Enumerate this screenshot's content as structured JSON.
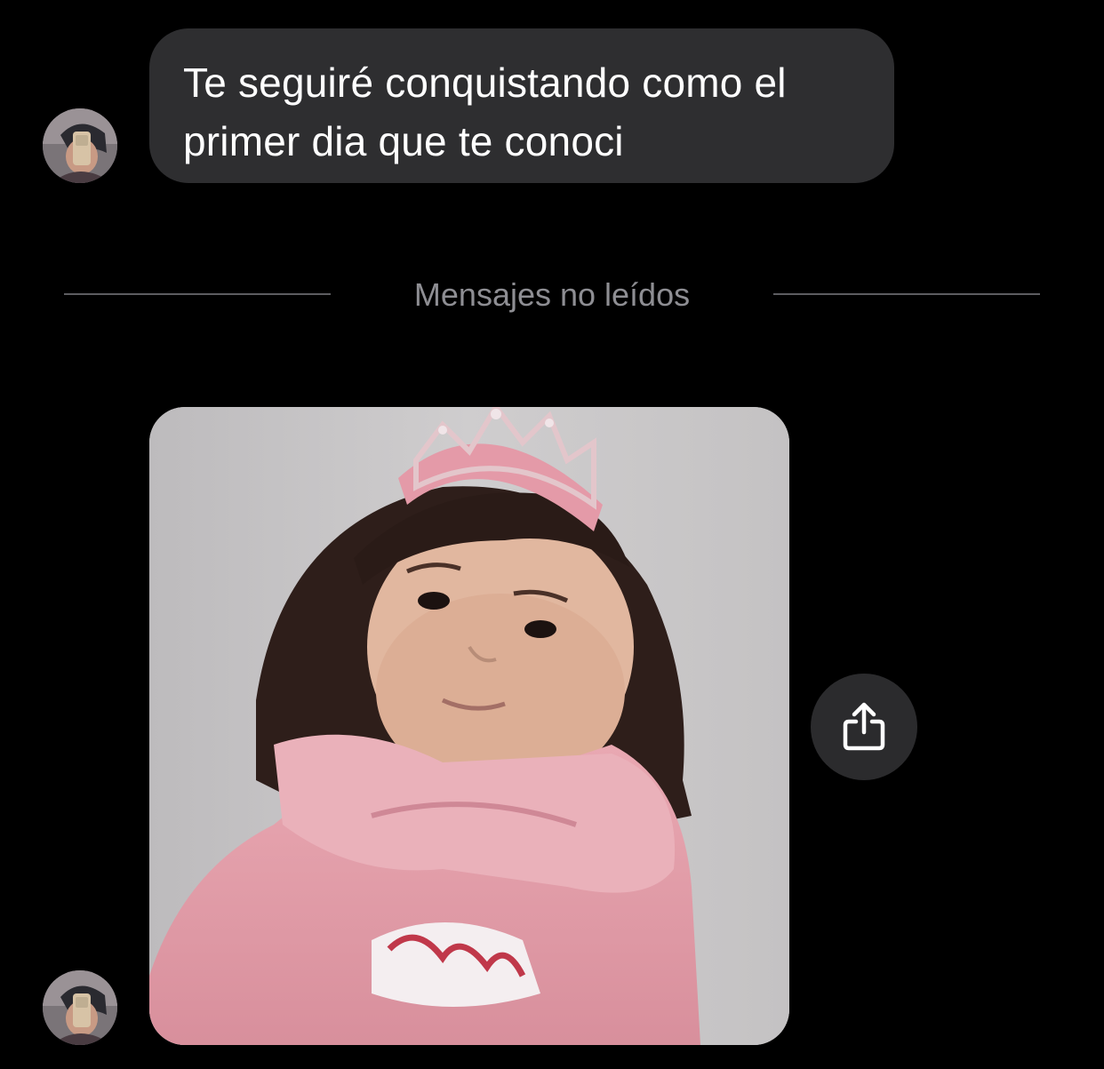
{
  "thread": {
    "messages": [
      {
        "type": "text",
        "text": "Te seguiré conquistando como el primer dia que te conoci",
        "avatar_icon": "profile-photo"
      },
      {
        "type": "image",
        "image_description": "photo",
        "avatar_icon": "profile-photo"
      }
    ],
    "unread_divider": {
      "label": "Mensajes no leídos"
    }
  },
  "actions": {
    "share_icon": "share-icon"
  },
  "colors": {
    "background": "#000000",
    "bubble": "#2e2e30",
    "divider_text": "#8e8e93",
    "divider_line": "#5d5d61",
    "share_button": "#2b2b2d"
  }
}
